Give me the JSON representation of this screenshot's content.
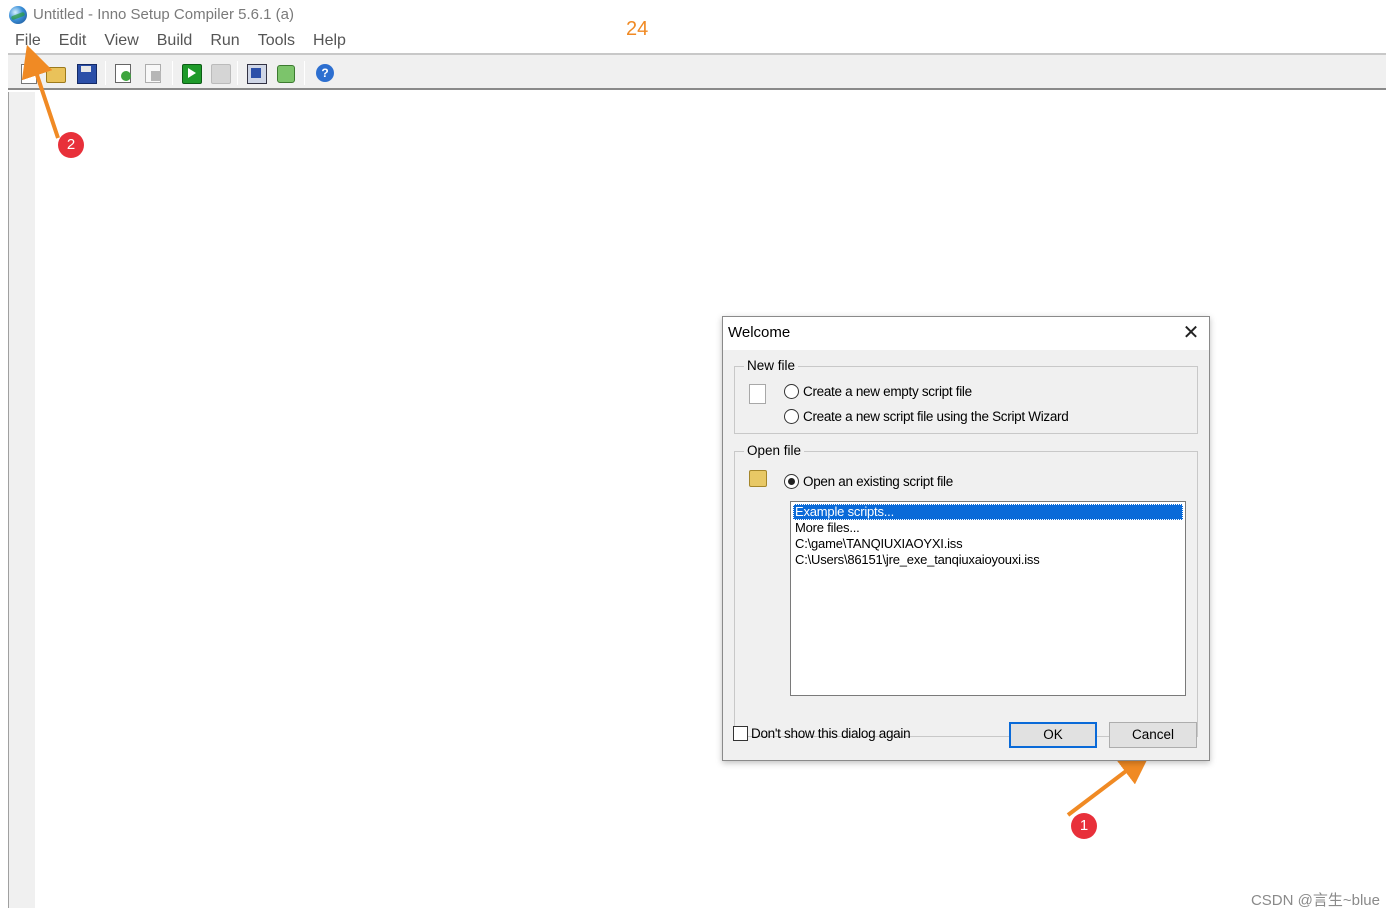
{
  "window": {
    "title": "Untitled - Inno Setup Compiler 5.6.1 (a)"
  },
  "annotations": {
    "top_number": "24",
    "badge_1": "1",
    "badge_2": "2"
  },
  "menu": {
    "items": [
      "File",
      "Edit",
      "View",
      "Build",
      "Run",
      "Tools",
      "Help"
    ]
  },
  "toolbar": {
    "icons": [
      "new-file-icon",
      "open-folder-icon",
      "save-icon",
      "compile-icon",
      "stop-compile-icon",
      "run-icon",
      "pause-icon",
      "target-setup-icon",
      "open-output-icon",
      "help-icon"
    ]
  },
  "dialog": {
    "title": "Welcome",
    "close_glyph": "✕",
    "new_file": {
      "group_label": "New file",
      "option_empty": "Create a new empty script file",
      "option_wizard": "Create a new script file using the Script Wizard"
    },
    "open_file": {
      "group_label": "Open file",
      "option_existing": "Open an existing script file",
      "list": [
        "Example scripts...",
        "More files...",
        "C:\\game\\TANQIUXIAOYXI.iss",
        "C:\\Users\\86151\\jre_exe_tanqiuxaioyouxi.iss"
      ]
    },
    "dont_show": "Don't show this dialog again",
    "ok_label": "OK",
    "cancel_label": "Cancel"
  },
  "watermark": "CSDN @言生~blue",
  "colors": {
    "accent": "#0a6ad8",
    "annotation_orange": "#f08a24",
    "badge_red": "#e8303a"
  }
}
